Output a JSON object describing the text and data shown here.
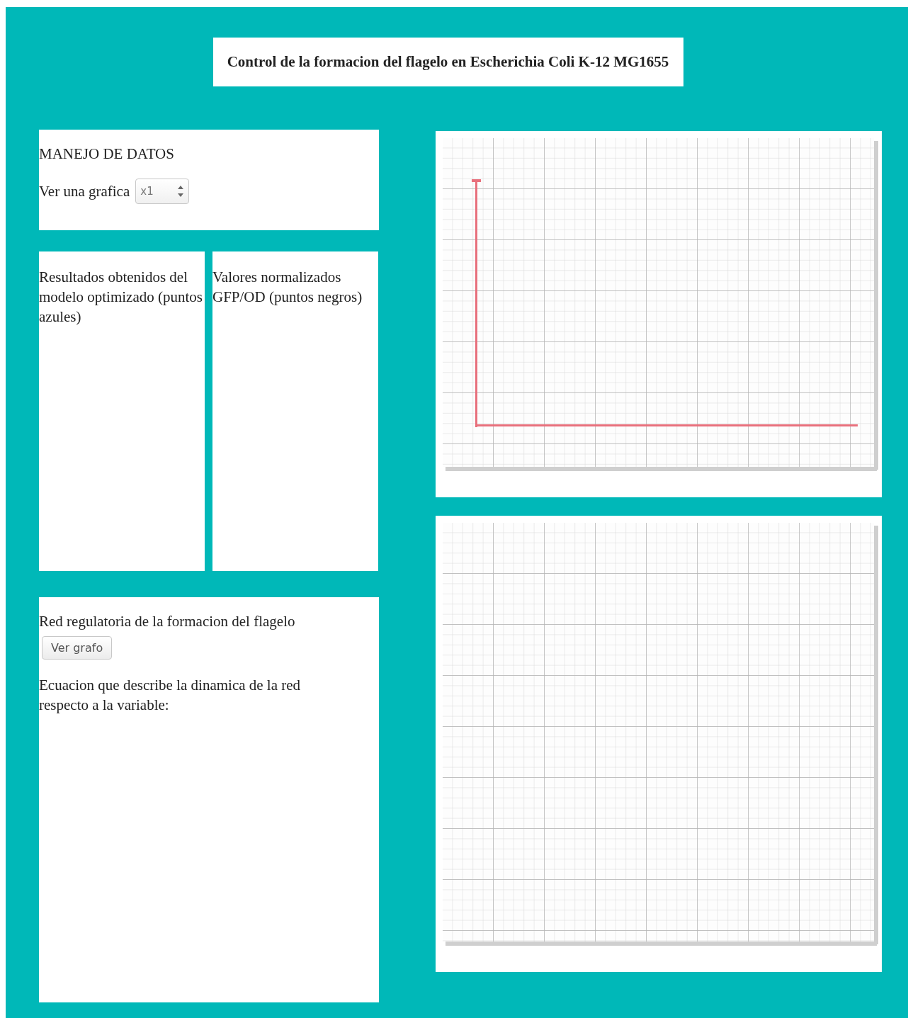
{
  "title": "Control de la formacion del flagelo en Escherichia Coli K-12 MG1655",
  "data_panel": {
    "heading": "MANEJO DE DATOS",
    "graph_label": "Ver una grafica",
    "graph_spinner": {
      "value": "x1"
    }
  },
  "legend_panels": [
    {
      "text": "Resultados obtenidos del modelo optimizado (puntos azules)"
    },
    {
      "text": "Valores normalizados GFP/OD (puntos negros)"
    }
  ],
  "network_panel": {
    "heading": "Red regulatoria de la formacion del flagelo",
    "button": "Ver grafo",
    "equation_label": "Ecuacion que describe la dinamica de la red respecto a la variable:"
  }
}
